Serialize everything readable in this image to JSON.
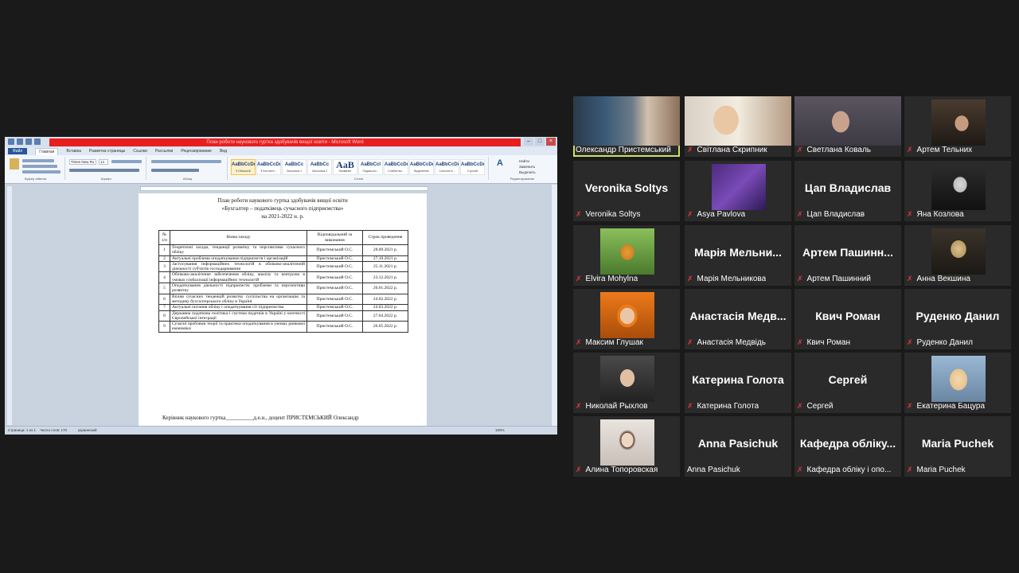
{
  "shared_screen": {
    "window_title": "План роботи наукового гуртка здобувачів вищої освіти - Microsoft Word",
    "ribbon_tabs": [
      "Файл",
      "Главная",
      "Вставка",
      "Разметка страницы",
      "Ссылки",
      "Рассылки",
      "Рецензирование",
      "Вид"
    ],
    "active_tab": "Главная",
    "font_name": "Times New Ro",
    "font_size": "14",
    "ribbon_groups": [
      "Буфер обмена",
      "Шрифт",
      "Абзац",
      "Стили",
      "Редактирование"
    ],
    "styles": [
      {
        "sample": "AaBbCcDd",
        "name": "¶ Обычный"
      },
      {
        "sample": "AaBbCcDd",
        "name": "¶ Без инте..."
      },
      {
        "sample": "AaBbCc",
        "name": "Заголовок 1"
      },
      {
        "sample": "AaBbCc",
        "name": "Заголовок 2"
      },
      {
        "sample": "AaB",
        "name": "Название"
      },
      {
        "sample": "AaBbCcI",
        "name": "Подзаголо..."
      },
      {
        "sample": "AaBbCcDd",
        "name": "Слабое вы..."
      },
      {
        "sample": "AaBbCcDd",
        "name": "Выделение"
      },
      {
        "sample": "AaBbCcDd",
        "name": "Сильное в..."
      },
      {
        "sample": "AaBbCcDd",
        "name": "Строгий"
      }
    ],
    "edit_buttons": [
      "Найти",
      "Заменить",
      "Выделить"
    ],
    "status_left": "Страница: 1 из 1",
    "status_words": "Число слов: 170",
    "status_lang": "украинский",
    "zoom": "100%"
  },
  "document": {
    "title_line1": "План роботи наукового гуртка здобувачів вищої освіти",
    "title_line2": "«Бухгалтер – податківець сучасного підприємства»",
    "title_line3": "на 2021-2022 н. р.",
    "columns": [
      "№ з/п",
      "Назва заходу",
      "Відповідальний за виконання",
      "Строк проведення"
    ],
    "rows": [
      {
        "n": "1",
        "event": "Теоретичні засади, тенденції розвитку та перспективи сучасного обліку",
        "responsible": "Пристемський О.С.",
        "date": "28.09.2021 р."
      },
      {
        "n": "2",
        "event": "Актуальні проблеми оподаткування підприємств і організацій",
        "responsible": "Пристемський О.С.",
        "date": "27.10.2021 р."
      },
      {
        "n": "3",
        "event": "Застосування інформаційних технологій в обліково-аналітичній діяльності суб'єктів господарювання",
        "responsible": "Пристемський О.С.",
        "date": "25.11.2021 р."
      },
      {
        "n": "4",
        "event": "Обліково-аналітичне забезпечення обліку, аналізу та контролю в умовах глобалізації інформаційних технологій",
        "responsible": "Пристемський О.С.",
        "date": "23.12.2021 р."
      },
      {
        "n": "5",
        "event": "Оподаткування діяльності підприємств: проблеми та перспективи розвитку",
        "responsible": "Пристемський О.С.",
        "date": "26.01.2022 р."
      },
      {
        "n": "6",
        "event": "Вплив сучасних тенденцій розвитку суспільства на організацію та методику бухгалтерського обліку в Україні",
        "responsible": "Пристемський О.С.",
        "date": "24.02.2022 р."
      },
      {
        "n": "7",
        "event": "Актуальні питання обліку і оподаткування сіт підприємства",
        "responsible": "Пристемський О.С.",
        "date": "24.03.2022 р."
      },
      {
        "n": "8",
        "event": "Державна податкова політика і система податків в Україні у контексті Європейської інтеграції",
        "responsible": "Пристемський О.С.",
        "date": "27.04.2022 р."
      },
      {
        "n": "9",
        "event": "Сучасні проблеми теорії та практики оподаткування в умовах ринкової економіки",
        "responsible": "Пристемський О.С.",
        "date": "26.05.2022 р."
      }
    ],
    "footer": "Керівник наукового гуртка__________д.е.н., доцент ПРИСТЕМСЬКИЙ Олександр"
  },
  "participants": [
    {
      "id": "p1",
      "label": "Олександр Пристемський",
      "big": "",
      "video": true,
      "muted": false,
      "active": true
    },
    {
      "id": "p2",
      "label": "Світлана Скрипник",
      "big": "",
      "video": true,
      "muted": true
    },
    {
      "id": "p3",
      "label": "Светлана Коваль",
      "big": "",
      "video": true,
      "muted": true
    },
    {
      "id": "p4",
      "label": "Артем Тельних",
      "big": "",
      "video": true,
      "muted": true
    },
    {
      "id": "p5",
      "label": "Veronika Soltys",
      "big": "Veronika Soltys",
      "video": false,
      "muted": true
    },
    {
      "id": "p6",
      "label": "Asya Pavlova",
      "big": "",
      "video": true,
      "muted": true
    },
    {
      "id": "p7",
      "label": "Цап Владислав",
      "big": "Цап Владислав",
      "video": false,
      "muted": true
    },
    {
      "id": "p8",
      "label": "Яна Козлова",
      "big": "",
      "video": true,
      "muted": true
    },
    {
      "id": "p9",
      "label": "Elvira Mohylna",
      "big": "",
      "video": true,
      "muted": true
    },
    {
      "id": "p10",
      "label": "Марія Мельникова",
      "big": "Марія Мельни...",
      "video": false,
      "muted": true
    },
    {
      "id": "p11",
      "label": "Артем Пашинний",
      "big": "Артем Пашинн...",
      "video": false,
      "muted": true
    },
    {
      "id": "p12",
      "label": "Анна Векшина",
      "big": "",
      "video": true,
      "muted": true
    },
    {
      "id": "p13",
      "label": "Максим Глушак",
      "big": "",
      "video": true,
      "muted": true
    },
    {
      "id": "p14",
      "label": "Анастасія Медвідь",
      "big": "Анастасія Медв...",
      "video": false,
      "muted": true
    },
    {
      "id": "p15",
      "label": "Квич Роман",
      "big": "Квич Роман",
      "video": false,
      "muted": true
    },
    {
      "id": "p16",
      "label": "Руденко Данил",
      "big": "Руденко Данил",
      "video": false,
      "muted": true
    },
    {
      "id": "p17",
      "label": "Николай Рыхлов",
      "big": "",
      "video": true,
      "muted": true
    },
    {
      "id": "p18",
      "label": "Катерина Голота",
      "big": "Катерина Голота",
      "video": false,
      "muted": true
    },
    {
      "id": "p19",
      "label": "Сергей",
      "big": "Сергей",
      "video": false,
      "muted": true
    },
    {
      "id": "p20",
      "label": "Екатерина Бацура",
      "big": "",
      "video": true,
      "muted": true
    },
    {
      "id": "p21",
      "label": "Алина Топоровская",
      "big": "",
      "video": true,
      "muted": true
    },
    {
      "id": "p22",
      "label": "Anna Pasichuk",
      "big": "Anna Pasichuk",
      "video": false,
      "muted": false
    },
    {
      "id": "p23",
      "label": "Кафедра обліку і опо...",
      "big": "Кафедра обліку...",
      "video": false,
      "muted": true
    },
    {
      "id": "p24",
      "label": "Maria Puchek",
      "big": "Maria Puchek",
      "video": false,
      "muted": true
    }
  ],
  "colors": {
    "background": "#1a1a1a",
    "tile": "#2a2a2a",
    "active_speaker_border": "#c9e265",
    "muted_mic": "#e0383a",
    "word_title_bar": "#e81e1e"
  },
  "icons": {
    "mic_muted": "muted-mic-icon"
  }
}
